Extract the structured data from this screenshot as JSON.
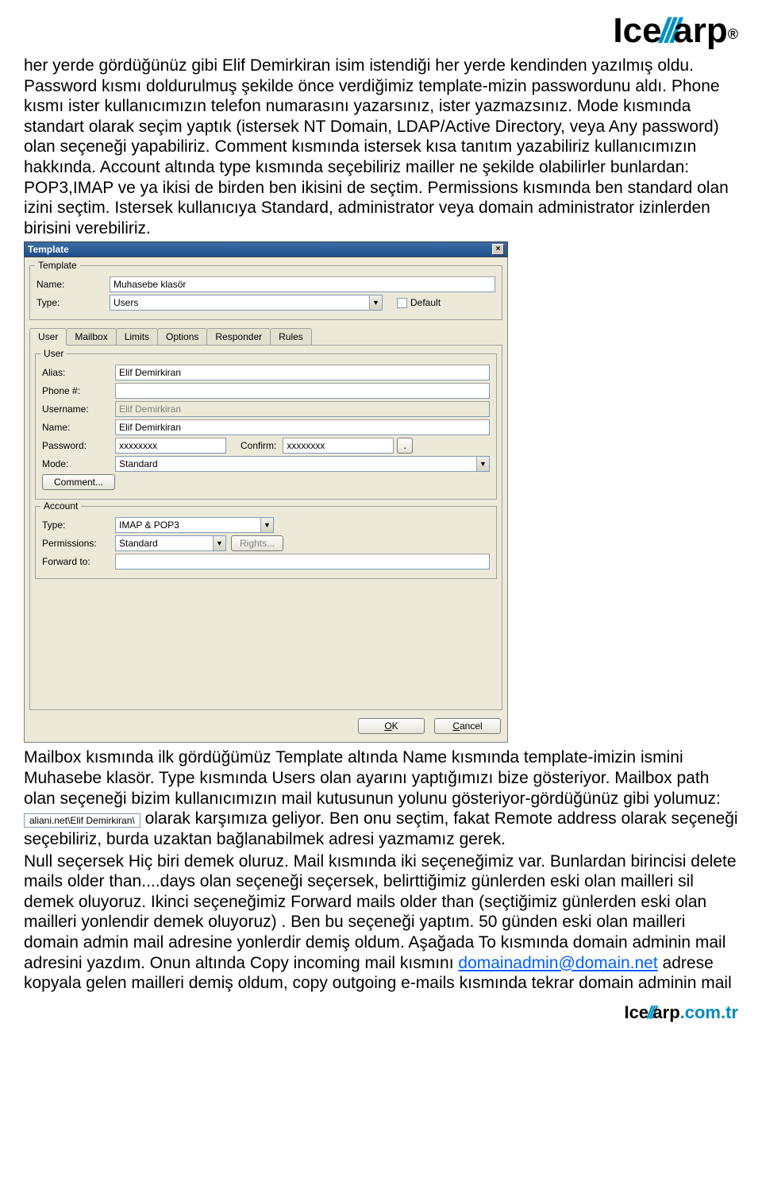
{
  "logo": {
    "part1": "Ice",
    "part2": "///",
    "part3": "arp",
    "reg": "®"
  },
  "para1": "her yerde gördüğünüz gibi Elif Demirkiran isim istendiği her yerde kendinden yazılmış oldu. Password kısmı doldurulmuş şekilde önce verdiğimiz template-mizin passwordunu aldı. Phone kısmı ister kullanıcımızın telefon numarasını yazarsınız, ister yazmazsınız. Mode kısmında standart olarak seçim yaptık (istersek NT Domain, LDAP/Active Directory, veya Any password) olan seçeneği yapabiliriz. Comment kısmında istersek kısa tanıtım yazabiliriz kullanıcımızın hakkında. Account altında type kısmında seçebiliriz mailler ne şekilde olabilirler bunlardan: POP3,IMAP ve ya ikisi de birden ben ikisini de seçtim. Permissions kısmında ben standard olan izini seçtim. Istersek kullanıcıya Standard, administrator veya domain administrator izinlerden birisini verebiliriz.",
  "dialog": {
    "title": "Template",
    "template": {
      "legend": "Template",
      "name_lbl": "Name:",
      "name_val": "Muhasebe klasör",
      "type_lbl": "Type:",
      "type_val": "Users",
      "default_lbl": "Default"
    },
    "tabs": [
      "User",
      "Mailbox",
      "Limits",
      "Options",
      "Responder",
      "Rules"
    ],
    "user": {
      "legend": "User",
      "alias_lbl": "Alias:",
      "alias_val": "Elif Demirkiran",
      "phone_lbl": "Phone #:",
      "phone_val": "",
      "username_lbl": "Username:",
      "username_val": "Elif Demirkiran",
      "name_lbl": "Name:",
      "name_val": "Elif Demirkiran",
      "password_lbl": "Password:",
      "password_val": "xxxxxxxx",
      "confirm_lbl": "Confirm:",
      "confirm_val": "xxxxxxxx",
      "mode_lbl": "Mode:",
      "mode_val": "Standard",
      "comment_btn": "Comment..."
    },
    "account": {
      "legend": "Account",
      "type_lbl": "Type:",
      "type_val": "IMAP & POP3",
      "perm_lbl": "Permissions:",
      "perm_val": "Standard",
      "rights_btn": "Rights...",
      "fwd_lbl": "Forward to:",
      "fwd_val": ""
    },
    "buttons": {
      "ok": "OK",
      "cancel": "Cancel"
    }
  },
  "para2a": "Mailbox kısmında ilk gördüğümüz Template altında Name kısmında template-imizin ismini Muhasebe klasör. Type kısmında Users olan ayarını yaptığımızı bize gösteriyor. Mailbox path olan seçeneği bizim kullanıcımızın mail kutusunun yolunu gösteriyor-gördüğünüz gibi yolumuz:",
  "inline_path": "aliani.net\\Elif Demirkiran\\",
  "para2b": " olarak karşımıza geliyor. Ben onu seçtim, fakat Remote address olarak seçeneği seçebiliriz, burda uzaktan bağlanabilmek adresi yazmamız gerek.",
  "para3a": "Null seçersek Hiç biri demek oluruz. Mail kısmında iki seçeneğimiz var. Bunlardan birincisi delete mails older than....days olan seçeneği seçersek, belirttiğimiz günlerden eski olan mailleri sil demek oluyoruz. Ikinci seçeneğimiz Forward mails older than (seçtiğimiz günlerden eski olan mailleri yonlendir demek oluyoruz) . Ben bu seçeneği yaptım. 50 günden eski olan mailleri domain admin mail adresine yonlerdir demiş oldum. Aşağada To kısmında domain adminin mail adresini yazdım. Onun altında Copy incoming mail kısmını ",
  "email_link": "domainadmin@domain.net",
  "para3b": " adrese kopyala gelen mailleri demiş oldum, copy outgoing e-mails kısmında tekrar domain adminin mail",
  "footer": {
    "p1": "Ice",
    "p2": "///",
    "p3": "arp",
    "dom": ".com.tr"
  }
}
